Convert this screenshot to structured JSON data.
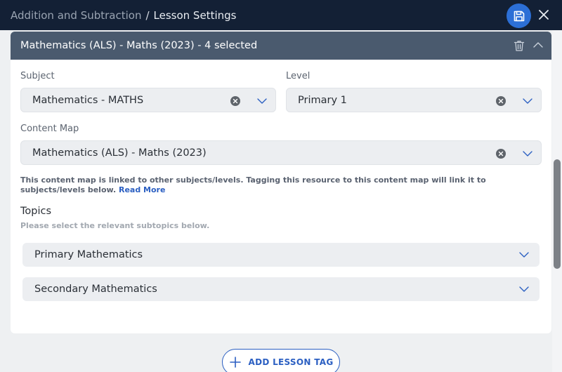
{
  "header": {
    "breadcrumb_parent": "Addition and Subtraction",
    "separator": "/",
    "current": "Lesson Settings",
    "save_icon": "save-icon",
    "close_icon": "close-icon"
  },
  "card": {
    "title": "Mathematics (ALS) - Maths (2023) - 4 selected",
    "delete_icon": "trash-icon",
    "collapse_icon": "chevron-up-icon"
  },
  "fields": {
    "subject": {
      "label": "Subject",
      "value": "Mathematics - MATHS"
    },
    "level": {
      "label": "Level",
      "value": "Primary 1"
    },
    "content_map": {
      "label": "Content Map",
      "value": "Mathematics (ALS) - Maths  (2023)"
    }
  },
  "note": {
    "text": "This content map is linked to other subjects/levels. Tagging this resource to this content map will link it to subjects/levels below.",
    "link": "Read More"
  },
  "topics": {
    "title": "Topics",
    "subtitle": "Please select the relevant subtopics below.",
    "items": [
      {
        "label": "Primary Mathematics"
      },
      {
        "label": "Secondary Mathematics"
      }
    ]
  },
  "actions": {
    "add_tag_label": "ADD LESSON TAG"
  },
  "colors": {
    "titlebar": "#132035",
    "card_header": "#4a5a6e",
    "accent": "#2b5fc2",
    "save_button": "#2c6fd6"
  }
}
